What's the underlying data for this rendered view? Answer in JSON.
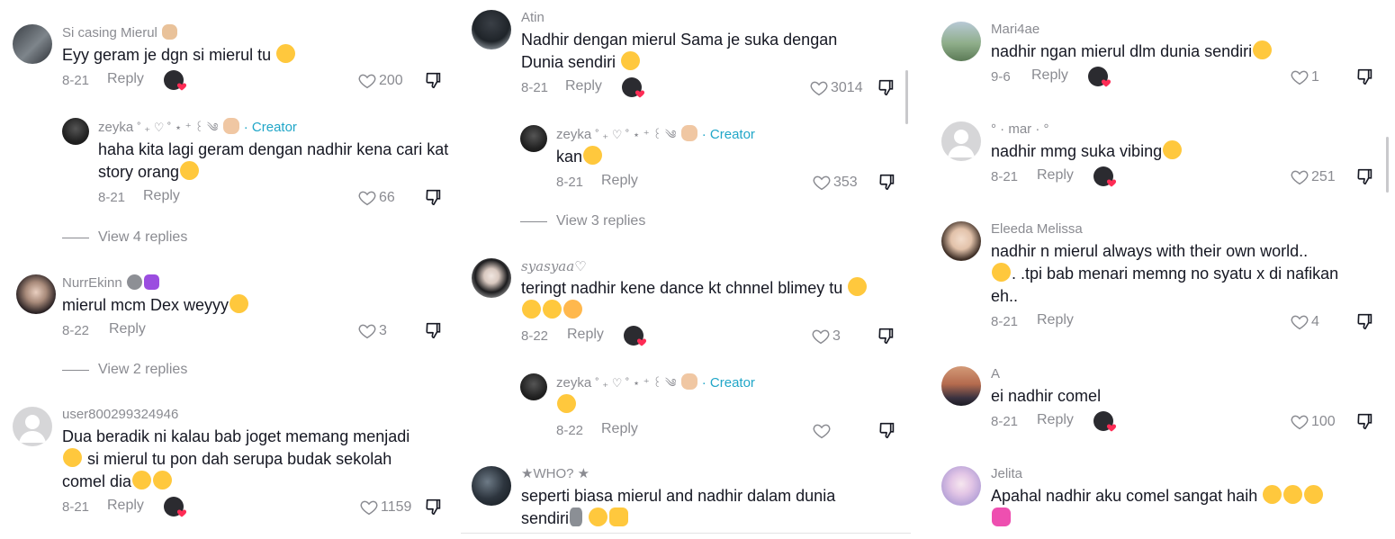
{
  "column1": {
    "c1": {
      "user": "Si casing Mierul",
      "text": "Eyy geram je dgn si mierul tu",
      "date": "8-21",
      "reply": "Reply",
      "likes": "200"
    },
    "c1r": {
      "user": "zeyka",
      "creator": "· Creator",
      "text": "haha kita lagi geram dengan nadhir kena cari kat story orang",
      "date": "8-21",
      "reply": "Reply",
      "likes": "66"
    },
    "c1v": "View 4 replies",
    "c2": {
      "user": "NurrEkinn",
      "text": "mierul mcm Dex weyyy",
      "date": "8-22",
      "reply": "Reply",
      "likes": "3"
    },
    "c2v": "View 2 replies",
    "c3": {
      "user": "user800299324946",
      "text": "Dua beradik ni kalau bab joget memang menjadi",
      "text2": "si mierul tu pon dah serupa budak sekolah",
      "text3": "comel dia",
      "date": "8-21",
      "reply": "Reply",
      "likes": "1159"
    }
  },
  "column2": {
    "c1": {
      "user": "Atin",
      "text": "Nadhir dengan mierul Sama je suka dengan",
      "text2": "Dunia sendiri",
      "date": "8-21",
      "reply": "Reply",
      "likes": "3014"
    },
    "c1r": {
      "user": "zeyka",
      "creator": "· Creator",
      "text": "kan",
      "date": "8-21",
      "reply": "Reply",
      "likes": "353"
    },
    "c1v": "View 3 replies",
    "c2": {
      "user": "syasyaa♡",
      "text": "teringt nadhir kene dance kt chnnel blimey tu",
      "date": "8-22",
      "reply": "Reply",
      "likes": "3"
    },
    "c2r": {
      "user": "zeyka",
      "creator": "· Creator",
      "date": "8-22",
      "reply": "Reply"
    },
    "c3": {
      "user": "★WHO? ★",
      "text": "seperti biasa mierul and nadhir dalam dunia",
      "text2": "sendiri"
    }
  },
  "column3": {
    "c1": {
      "user": "Mari4ae",
      "text": "nadhir ngan mierul dlm dunia sendiri",
      "date": "9-6",
      "reply": "Reply",
      "likes": "1"
    },
    "c2": {
      "user": "° · mar · °",
      "text": "nadhir mmg suka vibing",
      "date": "8-21",
      "reply": "Reply",
      "likes": "251"
    },
    "c3": {
      "user": "Eleeda Melissa",
      "text": "nadhir n mierul always with their own world..",
      "text2": ". .tpi bab menari memng no syatu x di nafikan",
      "text3": "eh..",
      "date": "8-21",
      "reply": "Reply",
      "likes": "4"
    },
    "c4": {
      "user": "A",
      "text": "ei nadhir comel",
      "date": "8-21",
      "reply": "Reply",
      "likes": "100"
    },
    "c5": {
      "user": "Jelita",
      "text": "Apahal nadhir aku comel sangat haih"
    }
  },
  "colors": {
    "text": "#161823",
    "muted": "#8a8b91",
    "creator": "#20a6c8",
    "heart_badge": "#fe2c55",
    "emoji": "#ffc83d"
  }
}
